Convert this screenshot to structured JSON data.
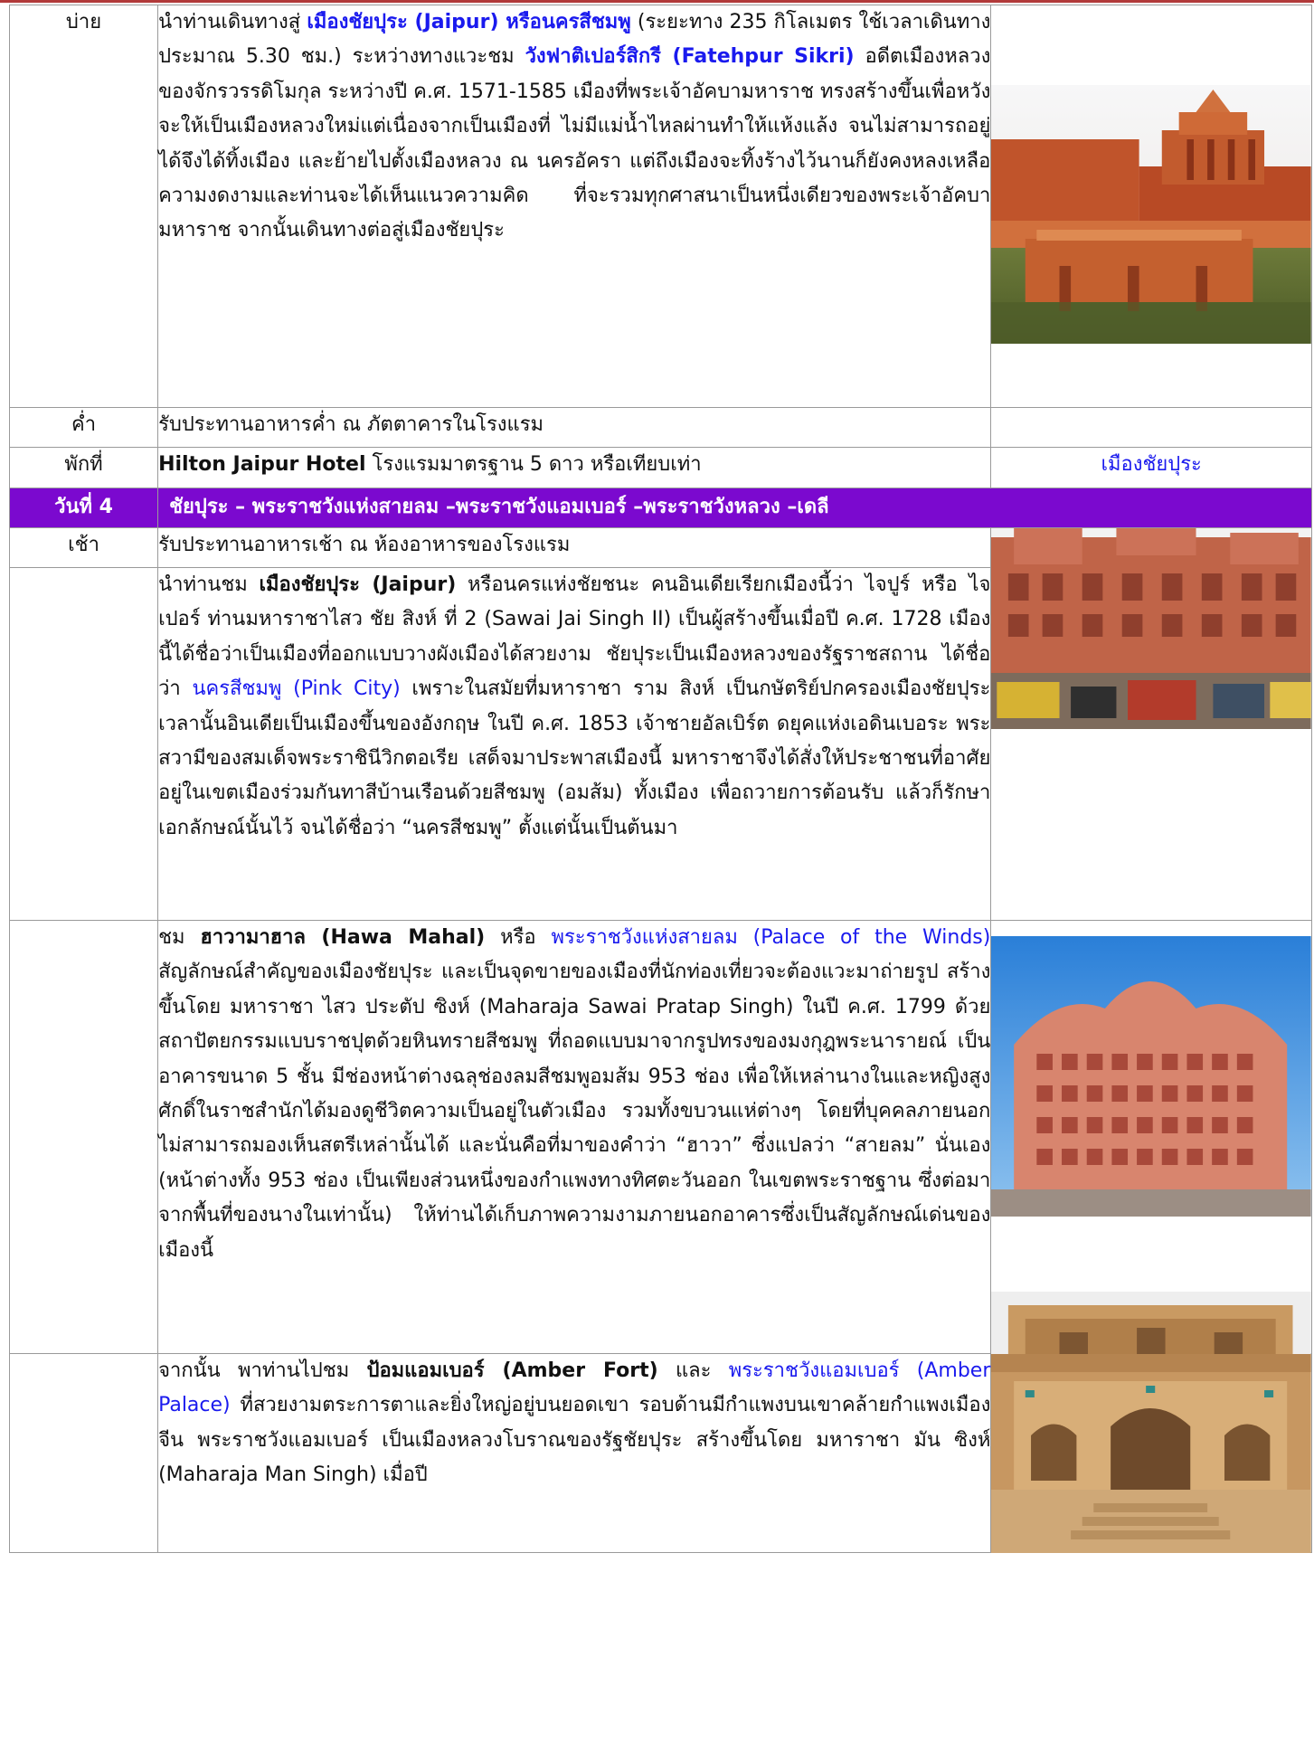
{
  "row_bai": {
    "label": "บ่าย",
    "t1": "นำท่านเดินทางสู่ ",
    "h1": "เมืองชัยปุระ (Jaipur) หรือนครสีชมพู",
    "t2": " (ระยะทาง 235 กิโลเมตร ใช้เวลาเดินทางประมาณ 5.30 ชม.) ระหว่างทางแวะชม ",
    "h2": "วังฟาติเปอร์สิกรี (Fatehpur Sikri)",
    "t3": " อดีตเมืองหลวงของจักรวรรดิโมกุล ระหว่างปี ค.ศ. 1571-1585 เมืองที่พระเจ้าอัคบามหาราช ทรงสร้างขึ้นเพื่อหวังจะให้เป็นเมืองหลวงใหม่แต่เนื่องจากเป็นเมืองที่ ไม่มีแม่น้ำไหลผ่านทำให้แห้งแล้ง จนไม่สามารถอยู่ได้จึงได้ทิ้งเมือง  และย้ายไปตั้งเมืองหลวง ณ นครอัครา แต่ถึงเมืองจะทิ้งร้างไว้นานก็ยังคงหลงเหลือความงดงามและท่านจะได้เห็นแนวความคิด  ที่จะรวมทุกศาสนาเป็นหนึ่งเดียวของพระเจ้าอัคบามหาราช จากนั้นเดินทางต่อสู่เมืองชัยปุระ"
  },
  "row_kham": {
    "label": "ค่ำ",
    "text": "รับประทานอาหารค่ำ ณ ภัตตาคารในโรงแรม"
  },
  "row_hotel": {
    "label": "พักที่",
    "hotel": "Hilton Jaipur Hotel",
    "text": " โรงแรมมาตรฐาน 5 ดาว หรือเทียบเท่า",
    "city": "เมืองชัยปุระ"
  },
  "day4": {
    "label": "วันที่ 4",
    "title": "ชัยปุระ – พระราชวังแห่งสายลม –พระราชวังแอมเบอร์ –พระราชวังหลวง –เดลี"
  },
  "row_chao": {
    "label": "เช้า",
    "text": "รับประทานอาหารเช้า ณ ห้องอาหารของโรงแรม"
  },
  "row_jaipur": {
    "t1": "นำท่านชม ",
    "b1": "เมืองชัยปุระ (Jaipur)",
    "t2": " หรือนครแห่งชัยชนะ คนอินเดียเรียกเมืองนี้ว่า ไจปูร์ หรือ ไจเปอร์ ท่านมหาราชาไสว ชัย สิงห์ ที่ 2 (Sawai Jai Singh II) เป็นผู้สร้างขึ้นเมื่อปี ค.ศ. 1728 เมืองนี้ได้ชื่อว่าเป็นเมืองที่ออกแบบวางผังเมืองได้สวยงาม ชัยปุระเป็นเมืองหลวงของรัฐราชสถาน ได้ชื่อว่า ",
    "h1": "นครสีชมพู (Pink City)",
    "t3": " เพราะในสมัยที่มหาราชา ราม สิงห์ เป็นกษัตริย์ปกครองเมืองชัยปุระ เวลานั้นอินเดียเป็นเมืองขึ้นของอังกฤษ ในปี ค.ศ. 1853 เจ้าชายอัลเบิร์ต ดยุคแห่งเอดินเบอระ พระสวามีของสมเด็จพระราชินีวิกตอเรีย เสด็จมาประพาสเมืองนี้ มหาราชาจึงได้สั่งให้ประชาชนที่อาศัยอยู่ในเขตเมืองร่วมกันทาสีบ้านเรือนด้วยสีชมพู (อมส้ม) ทั้งเมือง เพื่อถวายการต้อนรับ แล้วก็รักษาเอกลักษณ์นั้นไว้ จนได้ชื่อว่า “นครสีชมพู” ตั้งแต่นั้นเป็นต้นมา"
  },
  "row_hawa": {
    "t1": "ชม ",
    "b1": "ฮาวามาฮาล (Hawa Mahal)",
    "t2": " หรือ ",
    "h1": "พระราชวังแห่งสายลม (Palace of the Winds)",
    "t3": " สัญลักษณ์สำคัญของเมืองชัยปุระ และเป็นจุดขายของเมืองที่นักท่องเที่ยวจะต้องแวะมาถ่ายรูป สร้างขึ้นโดย มหาราชา ไสว ประตัป ซิงห์ (Maharaja Sawai Pratap Singh) ในปี ค.ศ. 1799 ด้วยสถาปัตยกรรมแบบราชปุตด้วยหินทรายสีชมพู ที่ถอดแบบมาจากรูปทรงของมงกุฎพระนารายณ์ เป็นอาคารขนาด 5 ชั้น มีช่องหน้าต่างฉลุช่องลมสีชมพูอมส้ม 953 ช่อง เพื่อให้เหล่านางในและหญิงสูงศักดิ์ในราชสำนักได้มองดูชีวิตความเป็นอยู่ในตัวเมือง รวมทั้งขบวนแห่ต่างๆ โดยที่บุคคลภายนอกไม่สามารถมองเห็นสตรีเหล่านั้นได้ และนั่นคือที่มาของคำว่า “ฮาวา” ซึ่งแปลว่า “สายลม” นั่นเอง (หน้าต่างทั้ง 953 ช่อง เป็นเพียงส่วนหนึ่งของกำแพงทางทิศตะวันออก ในเขตพระราชฐาน ซึ่งต่อมาจากพื้นที่ของนางในเท่านั้น) ให้ท่านได้เก็บภาพความงามภายนอกอาคารซึ่งเป็นสัญลักษณ์เด่นของเมืองนี้"
  },
  "row_amber": {
    "t1": "จากนั้น พาท่านไปชม ",
    "b1": "ป้อมแอมเบอร์ (Amber Fort)",
    "t2": " และ ",
    "h1": "พระราชวังแอมเบอร์ (Amber Palace)",
    "t3": " ที่สวยงามตระการตาและยิ่งใหญ่อยู่บนยอดเขา รอบด้านมีกำแพงบนเขาคล้ายกำแพงเมืองจีน พระราชวังแอมเบอร์ เป็นเมืองหลวงโบราณของรัฐชัยปุระ สร้างขึ้นโดย มหาราชา มัน ซิงห์ (Maharaja Man Singh) เมื่อปี"
  },
  "colors": {
    "day_header_bg": "#7b09cf",
    "link_blue": "#1a1aee",
    "border": "#9a9a9a"
  },
  "icons": [
    "photo-fatehpur-sikri",
    "photo-jaipur-street",
    "photo-hawa-mahal",
    "photo-amber-palace"
  ]
}
